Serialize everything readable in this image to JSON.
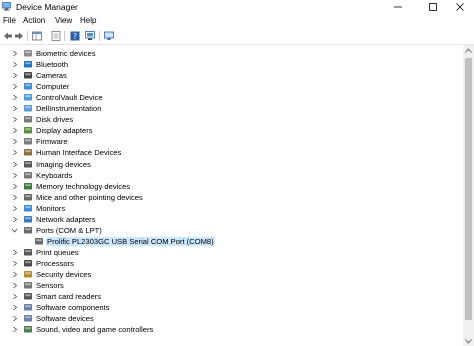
{
  "window": {
    "title": "Device Manager"
  },
  "menu": [
    "File",
    "Action",
    "View",
    "Help"
  ],
  "tree": {
    "items": [
      {
        "label": "Biometric devices",
        "icon": "biometric-icon",
        "expanded": false
      },
      {
        "label": "Bluetooth",
        "icon": "bluetooth-icon",
        "expanded": false
      },
      {
        "label": "Cameras",
        "icon": "camera-icon",
        "expanded": false
      },
      {
        "label": "Computer",
        "icon": "computer-icon",
        "expanded": false
      },
      {
        "label": "ControlVault Device",
        "icon": "controlvault-icon",
        "expanded": false
      },
      {
        "label": "DellInstrumentation",
        "icon": "dell-instrumentation-icon",
        "expanded": false
      },
      {
        "label": "Disk drives",
        "icon": "disk-drive-icon",
        "expanded": false
      },
      {
        "label": "Display adapters",
        "icon": "display-adapter-icon",
        "expanded": false
      },
      {
        "label": "Firmware",
        "icon": "firmware-icon",
        "expanded": false
      },
      {
        "label": "Human Interface Devices",
        "icon": "hid-icon",
        "expanded": false
      },
      {
        "label": "Imaging devices",
        "icon": "imaging-device-icon",
        "expanded": false
      },
      {
        "label": "Keyboards",
        "icon": "keyboard-icon",
        "expanded": false
      },
      {
        "label": "Memory technology devices",
        "icon": "memory-technology-icon",
        "expanded": false
      },
      {
        "label": "Mice and other pointing devices",
        "icon": "mouse-icon",
        "expanded": false
      },
      {
        "label": "Monitors",
        "icon": "monitor-icon",
        "expanded": false
      },
      {
        "label": "Network adapters",
        "icon": "network-adapter-icon",
        "expanded": false
      },
      {
        "label": "Ports (COM & LPT)",
        "icon": "port-icon",
        "expanded": true
      },
      {
        "label": "Prolific PL2303GC USB Serial COM Port (COM8)",
        "icon": "serial-port-icon",
        "child": true,
        "selected": true
      },
      {
        "label": "Print queues",
        "icon": "printer-icon",
        "expanded": false
      },
      {
        "label": "Processors",
        "icon": "processor-icon",
        "expanded": false
      },
      {
        "label": "Security devices",
        "icon": "security-device-icon",
        "expanded": false
      },
      {
        "label": "Sensors",
        "icon": "sensor-icon",
        "expanded": false
      },
      {
        "label": "Smart card readers",
        "icon": "smart-card-reader-icon",
        "expanded": false
      },
      {
        "label": "Software components",
        "icon": "software-component-icon",
        "expanded": false
      },
      {
        "label": "Software devices",
        "icon": "software-device-icon",
        "expanded": false
      },
      {
        "label": "Sound, video and game controllers",
        "icon": "sound-icon",
        "expanded": false
      }
    ]
  },
  "colors": {
    "selection": "#cce8ff",
    "accent": "#1e73be"
  }
}
